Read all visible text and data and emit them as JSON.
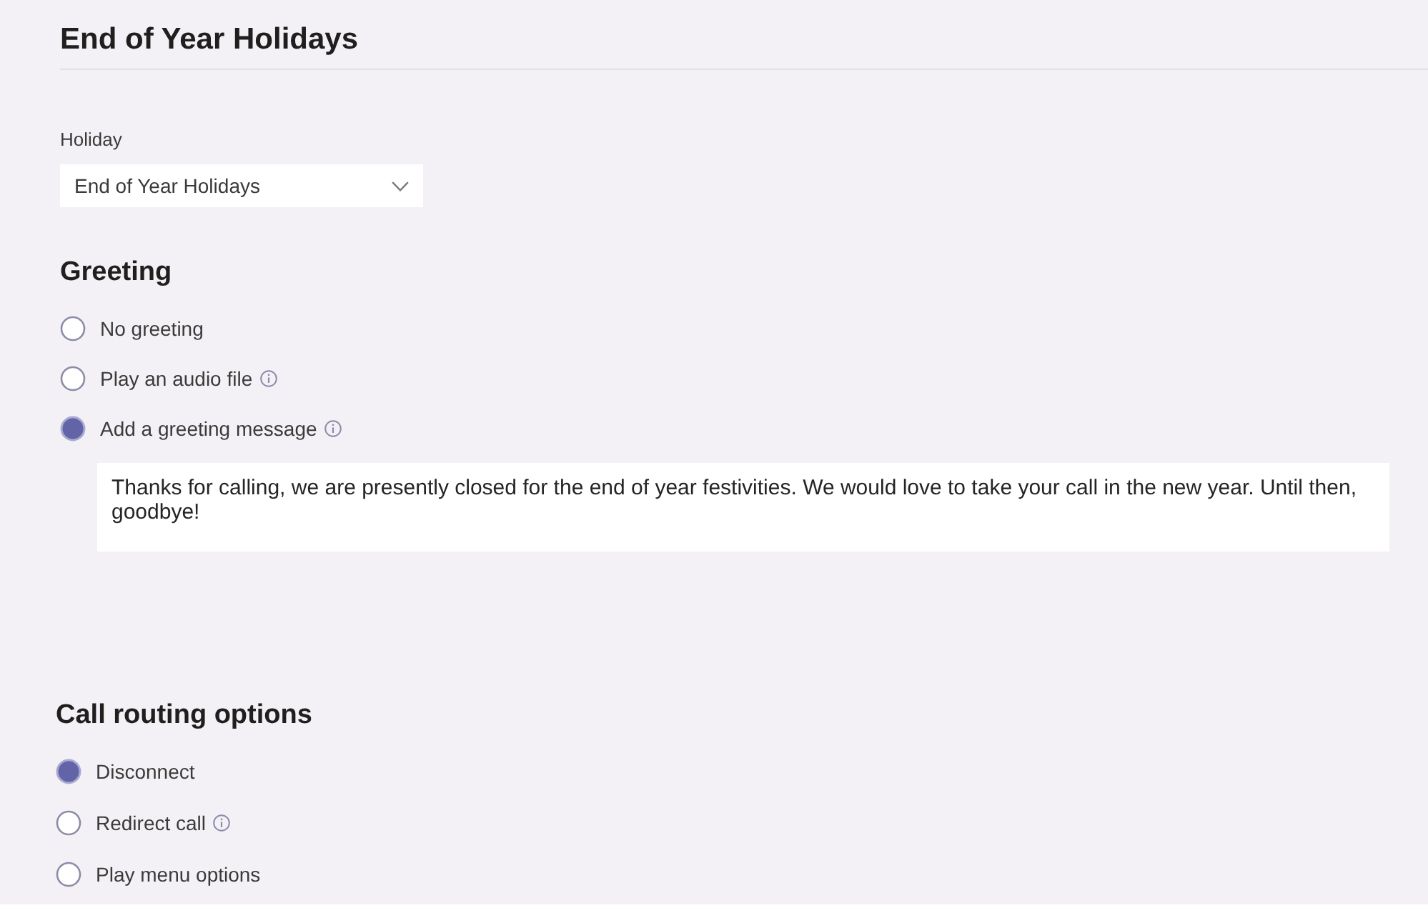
{
  "page": {
    "title": "End of Year Holidays"
  },
  "holiday": {
    "label": "Holiday",
    "value": "End of Year Holidays"
  },
  "greeting": {
    "heading": "Greeting",
    "options": [
      {
        "label": "No greeting",
        "selected": false,
        "info": false
      },
      {
        "label": "Play an audio file",
        "selected": false,
        "info": true
      },
      {
        "label": "Add a greeting message",
        "selected": true,
        "info": true
      }
    ],
    "message": "Thanks for calling, we are presently closed for the end of year festivities. We would love to take your call in the new year. Until then, goodbye!"
  },
  "call_routing": {
    "heading": "Call routing options",
    "options": [
      {
        "label": "Disconnect",
        "selected": true,
        "info": false
      },
      {
        "label": "Redirect call",
        "selected": false,
        "info": true
      },
      {
        "label": "Play menu options",
        "selected": false,
        "info": false
      }
    ]
  }
}
